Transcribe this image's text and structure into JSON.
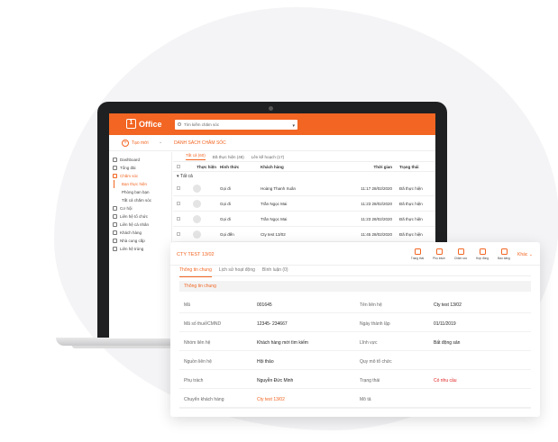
{
  "app": {
    "logo_text": "Office",
    "search_placeholder": "Tìm kiếm chăm sóc",
    "create_label": "Tạo mới",
    "section_title": "DANH SÁCH CHĂM SÓC",
    "accent_color": "#f26522"
  },
  "sidebar": {
    "items": [
      {
        "label": "Dashboard",
        "icon": "dashboard-icon"
      },
      {
        "label": "Tổng đài",
        "icon": "phone-icon"
      },
      {
        "label": "Chăm sóc",
        "icon": "care-icon"
      },
      {
        "label": "Cơ hội",
        "icon": "opportunity-icon"
      },
      {
        "label": "Liên hệ tổ chức",
        "icon": "organization-icon"
      },
      {
        "label": "Liên hệ cá nhân",
        "icon": "person-icon"
      },
      {
        "label": "Khách hàng",
        "icon": "customer-icon"
      },
      {
        "label": "Nhà cung cấp",
        "icon": "supplier-icon"
      },
      {
        "label": "Liên hệ trùng",
        "icon": "duplicate-icon"
      }
    ],
    "sub_items": [
      "Bạn thực hiện",
      "Phòng ban bạn",
      "Tất cả chăm sóc"
    ]
  },
  "main": {
    "tabs": [
      "Tất cả (60)",
      "Đã thực hiện (48)",
      "Lên kế hoạch (17)"
    ],
    "columns": [
      "Thực hiện",
      "Hình thức",
      "Khách hàng",
      "Thời gian",
      "Trạng thái"
    ],
    "group_label": "Tất cả",
    "rows": [
      {
        "form": "Gọi đi",
        "customer": "Hoàng Thanh Xuân",
        "time": "11:17 28/02/2020",
        "status": "Đã thực hiện"
      },
      {
        "form": "Gọi đi",
        "customer": "Trần Ngọc Mai",
        "time": "11:23 28/02/2020",
        "status": "Đã thực hiện"
      },
      {
        "form": "Gọi đi",
        "customer": "Trần Ngọc Mai",
        "time": "11:23 28/02/2020",
        "status": "Đã thực hiện"
      },
      {
        "form": "Gọi đến",
        "customer": "Cty test 13/02",
        "time": "11:45 28/02/2020",
        "status": "Đã thực hiện"
      }
    ]
  },
  "panel": {
    "title": "CTY TEST 13/02",
    "actions": [
      {
        "label": "Trang thái",
        "icon": "status-icon"
      },
      {
        "label": "Phụ trách",
        "icon": "assignee-icon"
      },
      {
        "label": "Chăm sóc",
        "icon": "care-icon"
      },
      {
        "label": "Hợp đồng",
        "icon": "contract-icon"
      },
      {
        "label": "Báo bảng",
        "icon": "report-icon"
      }
    ],
    "more_label": "Khác",
    "tabs": [
      "Thông tin chung",
      "Lịch sử hoạt động",
      "Bình luận (0)"
    ],
    "section_title": "Thông tin chung",
    "fields": [
      {
        "l1": "Mã",
        "v1": "001645",
        "l2": "Tên liên hệ",
        "v2": "Cty test 13/02"
      },
      {
        "l1": "Mã số thuế/CMND",
        "v1": "12345- 234667",
        "l2": "Ngày thành lập",
        "v2": "01/11/2019"
      },
      {
        "l1": "Nhóm liên hệ",
        "v1": "Khách hàng mới tìm kiếm",
        "l2": "Lĩnh vực",
        "v2": "Bất động sản"
      },
      {
        "l1": "Nguồn liên hệ",
        "v1": "Hội thảo",
        "l2": "Quy mô tổ chức",
        "v2": ""
      },
      {
        "l1": "Phụ trách",
        "v1": "Nguyễn Đức Minh",
        "l2": "Trạng thái",
        "v2": "Có nhu cầu"
      },
      {
        "l1": "Chuyển khách hàng",
        "v1": "Cty test 13/02",
        "l2": "Mô tả",
        "v2": ""
      }
    ]
  }
}
